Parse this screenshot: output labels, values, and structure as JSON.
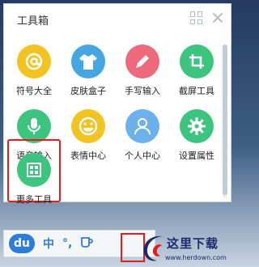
{
  "panel": {
    "title": "工具箱"
  },
  "tools": [
    {
      "label": "符号大全",
      "icon": "at-symbol-icon",
      "color": "#f3c321"
    },
    {
      "label": "皮肤盒子",
      "icon": "tshirt-icon",
      "color": "#45a6e2"
    },
    {
      "label": "手写输入",
      "icon": "pencil-icon",
      "color": "#ec6a7c"
    },
    {
      "label": "截屏工具",
      "icon": "crop-icon",
      "color": "#3dc47e"
    },
    {
      "label": "语音输入",
      "icon": "microphone-icon",
      "color": "#3dc47e"
    },
    {
      "label": "表情中心",
      "icon": "smiley-icon",
      "color": "#f3c321"
    },
    {
      "label": "个人中心",
      "icon": "user-icon",
      "color": "#6cb1ea"
    },
    {
      "label": "设置属性",
      "icon": "gear-icon",
      "color": "#3dc47e"
    },
    {
      "label": "更多工具",
      "icon": "grid-icon",
      "color": "#3dc47e"
    }
  ],
  "ime_bar": {
    "logo": "du",
    "mode": "中",
    "punct": "°,"
  },
  "watermark": {
    "title": "这里下载",
    "url": "www.herdown.com"
  }
}
